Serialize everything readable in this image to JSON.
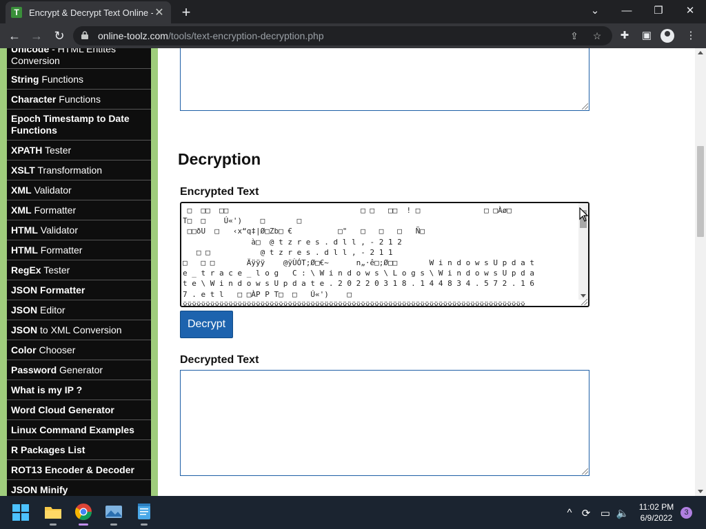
{
  "browser": {
    "tab_title": "Encrypt & Decrypt Text Online - O",
    "favicon_letter": "T",
    "url_domain": "online-toolz.com",
    "url_path": "/tools/text-encryption-decryption.php"
  },
  "sidebar": {
    "items": [
      {
        "bold": "Unicode",
        "rest": " - HTML Entites Conversion"
      },
      {
        "bold": "String",
        "rest": " Functions"
      },
      {
        "bold": "Character",
        "rest": " Functions"
      },
      {
        "bold": "Epoch Timestamp to Date Functions",
        "rest": ""
      },
      {
        "bold": "XPATH",
        "rest": " Tester"
      },
      {
        "bold": "XSLT",
        "rest": " Transformation"
      },
      {
        "bold": "XML",
        "rest": " Validator"
      },
      {
        "bold": "XML",
        "rest": " Formatter"
      },
      {
        "bold": "HTML",
        "rest": " Validator"
      },
      {
        "bold": "HTML",
        "rest": " Formatter"
      },
      {
        "bold": "RegEx",
        "rest": " Tester"
      },
      {
        "bold": "JSON Formatter",
        "rest": ""
      },
      {
        "bold": "JSON",
        "rest": " Editor"
      },
      {
        "bold": "JSON",
        "rest": " to XML Conversion"
      },
      {
        "bold": "Color",
        "rest": " Chooser"
      },
      {
        "bold": "Password",
        "rest": " Generator"
      },
      {
        "bold": "What is my IP ?",
        "rest": ""
      },
      {
        "bold": "Word Cloud Generator",
        "rest": ""
      },
      {
        "bold": "Linux Command Examples",
        "rest": ""
      },
      {
        "bold": "R Packages List",
        "rest": ""
      },
      {
        "bold": "ROT13 Encoder & Decoder",
        "rest": ""
      },
      {
        "bold": "JSON Minify",
        "rest": ""
      }
    ]
  },
  "main": {
    "heading": "Decryption",
    "encrypted_label": "Encrypted Text",
    "encrypted_value": " □  □□  □□                             □ □   □□  ! □              □ □Àø□\nT□  □    Ú«')    □       □\n □□ðU  □   ‹x“q‡|Ø□Zb□ €          □\"   □   □   □   Ñ□\n               à□  @ t z r e s . d l l , - 2 1 2\n   □ □           @ t z r e s . d l l , - 2 1 1\n□   □ □       Äÿÿÿ    @ÿÙÓT;Ø□€~      n„·ê□;Ø□□       W i n d o w s U p d a t\ne _ t r a c e _ l o g   C : \\ W i n d o w s \\ L o g s \\ W i n d o w s U p d a\nt e \\ W i n d o w s U p d a t e . 2 0 2 2 0 3 1 8 . 1 4 4 8 3 4 . 5 7 2 . 1 6\n7 . e t l   □ □ÀP P T□  □   Ú«')    □\nÿÿÿÿÿÿÿÿÿÿÿÿÿÿÿÿÿÿÿÿÿÿÿÿÿÿÿÿÿÿÿÿÿÿÿÿÿÿÿÿÿÿÿÿÿÿÿÿÿÿÿÿÿÿÿÿÿÿÿÿÿÿÿÿÿÿÿÿÿÿÿÿÿÿÿ",
    "decrypt_button": "Decrypt",
    "decrypted_label": "Decrypted Text",
    "decrypted_value": ""
  },
  "taskbar": {
    "time": "11:02 PM",
    "date": "6/9/2022",
    "notification_count": "3"
  },
  "colors": {
    "sidebar_bg": "#0e0e0e",
    "sidebar_accent": "#9fcd7c",
    "button_blue": "#1d63ae",
    "textbox_border": "#1c5ea5"
  }
}
